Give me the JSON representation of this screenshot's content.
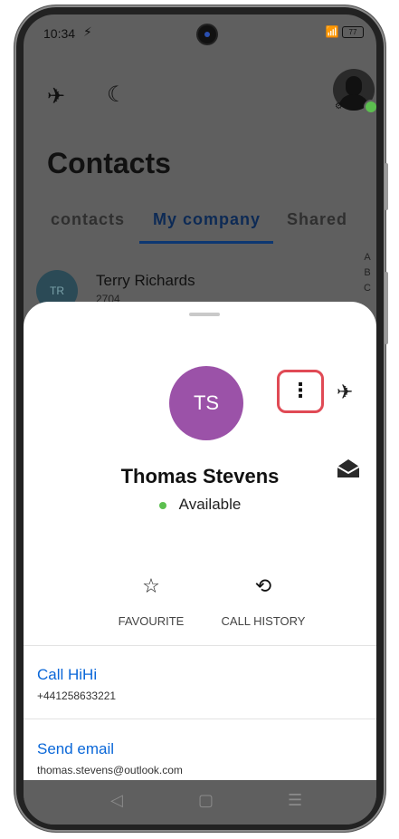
{
  "status_bar": {
    "time": "10:34",
    "battery": "77"
  },
  "background": {
    "title": "Contacts",
    "tabs": [
      {
        "label": "contacts",
        "active": false
      },
      {
        "label": "My company",
        "active": true
      },
      {
        "label": "Shared",
        "active": false
      }
    ],
    "index_letters": [
      "A",
      "B",
      "C"
    ],
    "rows": [
      {
        "initials": "TR",
        "name": "Terry Richards",
        "extension": "2704"
      }
    ]
  },
  "sheet": {
    "initials": "TS",
    "name": "Thomas Stevens",
    "status": "Available",
    "actions": {
      "favourite": "FAVOURITE",
      "call_history": "CALL HISTORY"
    },
    "entries": {
      "call": {
        "title": "Call HiHi",
        "subtitle": "+441258633221"
      },
      "email": {
        "title": "Send email",
        "subtitle": "thomas.stevens@outlook.com"
      }
    }
  },
  "colors": {
    "avatar_ts": "#9b52a8",
    "link_blue": "#0a67d8",
    "online_green": "#5cbf4f",
    "highlight_red": "#e04a55"
  }
}
